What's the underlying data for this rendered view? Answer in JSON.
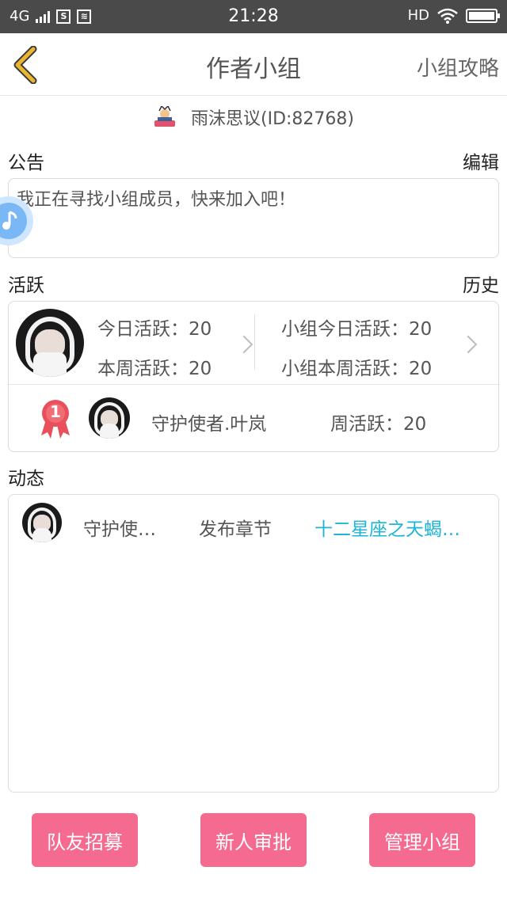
{
  "status_bar": {
    "network": "4G",
    "time": "21:28",
    "hd": "HD"
  },
  "nav": {
    "title": "作者小组",
    "right_link": "小组攻略"
  },
  "group": {
    "owner_text": "雨沫思议(ID:82768)"
  },
  "notice": {
    "label": "公告",
    "edit": "编辑",
    "text": "我正在寻找小组成员，快来加入吧！"
  },
  "activity": {
    "label": "活跃",
    "history": "历史",
    "today": "今日活跃：20",
    "week": "本周活跃：20",
    "group_today": "小组今日活跃：20",
    "group_week": "小组本周活跃：20",
    "rank_number": "1",
    "top_member_name": "守护使者.叶岚",
    "top_member_weekly": "周活跃：20"
  },
  "feed": {
    "label": "动态",
    "items": [
      {
        "user": "守护使…",
        "action": "发布章节",
        "target": "十二星座之天蝎…"
      }
    ]
  },
  "buttons": {
    "recruit": "队友招募",
    "approve": "新人审批",
    "manage": "管理小组"
  },
  "colors": {
    "accent_pink": "#f56b90",
    "link_blue": "#1fb5d6",
    "back_arrow": "#e9b631"
  }
}
